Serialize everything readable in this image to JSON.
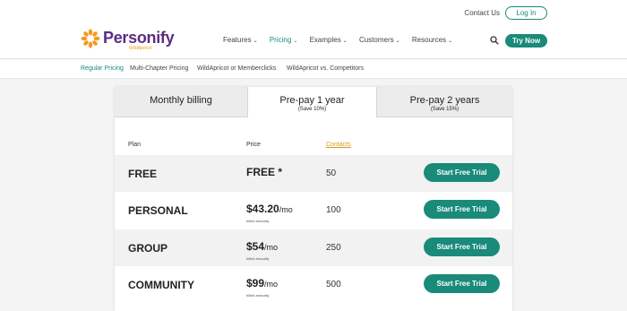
{
  "header": {
    "contact_link": "Contact Us",
    "login_label": "Log In",
    "logo_text": "Personify",
    "logo_sub": "WildApricot",
    "nav": [
      {
        "label": "Features",
        "active": false
      },
      {
        "label": "Pricing",
        "active": true
      },
      {
        "label": "Examples",
        "active": false
      },
      {
        "label": "Customers",
        "active": false
      },
      {
        "label": "Resources",
        "active": false
      }
    ],
    "try_label": "Try Now"
  },
  "subnav": [
    "Regular Pricing",
    "Multi-Chapter Pricing",
    "WildApricot or Memberclicks",
    "WildApricot vs. Competitors"
  ],
  "tabs": [
    {
      "label": "Monthly billing",
      "sub": ""
    },
    {
      "label": "Pre-pay 1 year",
      "sub": "(Save 10%)"
    },
    {
      "label": "Pre-pay 2 years",
      "sub": "(Save 15%)"
    }
  ],
  "columns": {
    "plan": "Plan",
    "price": "Price",
    "contacts": "Contacts"
  },
  "plans": [
    {
      "name": "FREE",
      "price": "FREE *",
      "per": "",
      "billed": "",
      "contacts": "50",
      "cta": "Start Free Trial"
    },
    {
      "name": "PERSONAL",
      "price": "$43.20",
      "per": "/mo",
      "billed": "billed annually",
      "contacts": "100",
      "cta": "Start Free Trial"
    },
    {
      "name": "GROUP",
      "price": "$54",
      "per": "/mo",
      "billed": "billed annually",
      "contacts": "250",
      "cta": "Start Free Trial"
    },
    {
      "name": "COMMUNITY",
      "price": "$99",
      "per": "/mo",
      "billed": "billed annually",
      "contacts": "500",
      "cta": "Start Free Trial"
    }
  ],
  "colors": {
    "accent": "#1a8a7a",
    "brand": "#5b2c83",
    "orange": "#f39a1e",
    "contacts_link": "#d49a1c"
  },
  "icons": [
    "logo-flower-icon",
    "search-icon",
    "chevron-down-icon"
  ]
}
